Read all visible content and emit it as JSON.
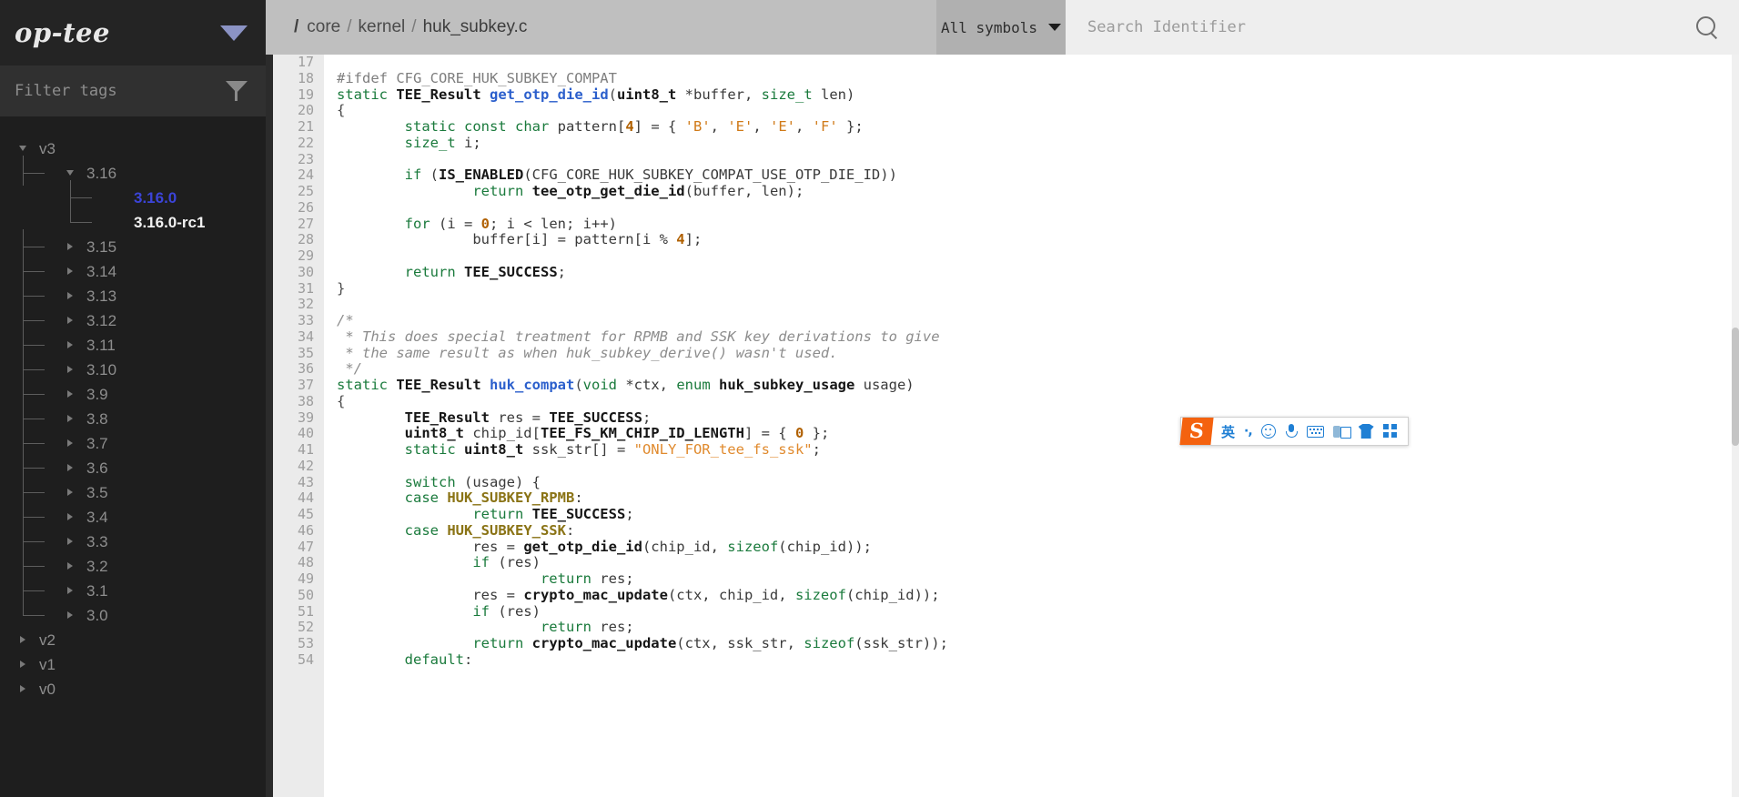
{
  "sidebar": {
    "logo": "op-tee",
    "collapse_icon": "caret-down-icon",
    "filter": {
      "placeholder": "Filter tags",
      "value": "",
      "icon": "funnel-icon"
    },
    "tree": [
      {
        "label": "v3",
        "level": 0,
        "state": "open",
        "kind": "branch",
        "guide": "none"
      },
      {
        "label": "3.16",
        "level": 1,
        "state": "open",
        "kind": "branch",
        "guide": "tee"
      },
      {
        "label": "3.16.0",
        "level": 2,
        "state": "none",
        "kind": "leaf-sel",
        "guide": "tee"
      },
      {
        "label": "3.16.0-rc1",
        "level": 2,
        "state": "none",
        "kind": "leaf",
        "guide": "last"
      },
      {
        "label": "3.15",
        "level": 1,
        "state": "closed",
        "kind": "branch",
        "guide": "tee"
      },
      {
        "label": "3.14",
        "level": 1,
        "state": "closed",
        "kind": "branch",
        "guide": "tee"
      },
      {
        "label": "3.13",
        "level": 1,
        "state": "closed",
        "kind": "branch",
        "guide": "tee"
      },
      {
        "label": "3.12",
        "level": 1,
        "state": "closed",
        "kind": "branch",
        "guide": "tee"
      },
      {
        "label": "3.11",
        "level": 1,
        "state": "closed",
        "kind": "branch",
        "guide": "tee"
      },
      {
        "label": "3.10",
        "level": 1,
        "state": "closed",
        "kind": "branch",
        "guide": "tee"
      },
      {
        "label": "3.9",
        "level": 1,
        "state": "closed",
        "kind": "branch",
        "guide": "tee"
      },
      {
        "label": "3.8",
        "level": 1,
        "state": "closed",
        "kind": "branch",
        "guide": "tee"
      },
      {
        "label": "3.7",
        "level": 1,
        "state": "closed",
        "kind": "branch",
        "guide": "tee"
      },
      {
        "label": "3.6",
        "level": 1,
        "state": "closed",
        "kind": "branch",
        "guide": "tee"
      },
      {
        "label": "3.5",
        "level": 1,
        "state": "closed",
        "kind": "branch",
        "guide": "tee"
      },
      {
        "label": "3.4",
        "level": 1,
        "state": "closed",
        "kind": "branch",
        "guide": "tee"
      },
      {
        "label": "3.3",
        "level": 1,
        "state": "closed",
        "kind": "branch",
        "guide": "tee"
      },
      {
        "label": "3.2",
        "level": 1,
        "state": "closed",
        "kind": "branch",
        "guide": "tee"
      },
      {
        "label": "3.1",
        "level": 1,
        "state": "closed",
        "kind": "branch",
        "guide": "tee"
      },
      {
        "label": "3.0",
        "level": 1,
        "state": "closed",
        "kind": "branch",
        "guide": "last"
      },
      {
        "label": "v2",
        "level": 0,
        "state": "closed",
        "kind": "branch",
        "guide": "none"
      },
      {
        "label": "v1",
        "level": 0,
        "state": "closed",
        "kind": "branch",
        "guide": "none"
      },
      {
        "label": "v0",
        "level": 0,
        "state": "closed",
        "kind": "branch",
        "guide": "none"
      }
    ]
  },
  "topbar": {
    "breadcrumb": {
      "root": "/",
      "segments": [
        "core",
        "kernel",
        "huk_subkey.c"
      ],
      "separator": "/"
    },
    "symbol_filter": {
      "label": "All symbols",
      "icon": "chevron-down-icon"
    },
    "search": {
      "placeholder": "Search Identifier",
      "value": "",
      "icon": "search-icon"
    }
  },
  "code": {
    "first_visible_line": 17,
    "lines": [
      {
        "n": 17,
        "tokens": []
      },
      {
        "n": 18,
        "tokens": [
          {
            "t": "#ifdef ",
            "c": "pp"
          },
          {
            "t": "CFG_CORE_HUK_SUBKEY_COMPAT",
            "c": "pp"
          }
        ]
      },
      {
        "n": 19,
        "tokens": [
          {
            "t": "static ",
            "c": "kw"
          },
          {
            "t": "TEE_Result",
            "c": "typ"
          },
          {
            "t": " ",
            "c": "pln"
          },
          {
            "t": "get_otp_die_id",
            "c": "fn"
          },
          {
            "t": "(",
            "c": "op"
          },
          {
            "t": "uint8_t",
            "c": "typ"
          },
          {
            "t": " *buffer, ",
            "c": "pln"
          },
          {
            "t": "size_t",
            "c": "kw"
          },
          {
            "t": " len)",
            "c": "pln"
          }
        ]
      },
      {
        "n": 20,
        "tokens": [
          {
            "t": "{",
            "c": "op"
          }
        ]
      },
      {
        "n": 21,
        "tokens": [
          {
            "t": "        ",
            "c": "pln"
          },
          {
            "t": "static ",
            "c": "kw"
          },
          {
            "t": "const ",
            "c": "kw"
          },
          {
            "t": "char",
            "c": "kw"
          },
          {
            "t": " pattern[",
            "c": "pln"
          },
          {
            "t": "4",
            "c": "num"
          },
          {
            "t": "] = { ",
            "c": "pln"
          },
          {
            "t": "'B'",
            "c": "chr"
          },
          {
            "t": ", ",
            "c": "pln"
          },
          {
            "t": "'E'",
            "c": "chr"
          },
          {
            "t": ", ",
            "c": "pln"
          },
          {
            "t": "'E'",
            "c": "chr"
          },
          {
            "t": ", ",
            "c": "pln"
          },
          {
            "t": "'F'",
            "c": "chr"
          },
          {
            "t": " };",
            "c": "pln"
          }
        ]
      },
      {
        "n": 22,
        "tokens": [
          {
            "t": "        ",
            "c": "pln"
          },
          {
            "t": "size_t",
            "c": "kw"
          },
          {
            "t": " i;",
            "c": "pln"
          }
        ]
      },
      {
        "n": 23,
        "tokens": []
      },
      {
        "n": 24,
        "tokens": [
          {
            "t": "        ",
            "c": "pln"
          },
          {
            "t": "if",
            "c": "kw"
          },
          {
            "t": " (",
            "c": "pln"
          },
          {
            "t": "IS_ENABLED",
            "c": "mac"
          },
          {
            "t": "(CFG_CORE_HUK_SUBKEY_COMPAT_USE_OTP_DIE_ID))",
            "c": "pln"
          }
        ]
      },
      {
        "n": 25,
        "tokens": [
          {
            "t": "                ",
            "c": "pln"
          },
          {
            "t": "return",
            "c": "kw"
          },
          {
            "t": " ",
            "c": "pln"
          },
          {
            "t": "tee_otp_get_die_id",
            "c": "mac"
          },
          {
            "t": "(buffer, len);",
            "c": "pln"
          }
        ]
      },
      {
        "n": 26,
        "tokens": []
      },
      {
        "n": 27,
        "tokens": [
          {
            "t": "        ",
            "c": "pln"
          },
          {
            "t": "for",
            "c": "kw"
          },
          {
            "t": " (i = ",
            "c": "pln"
          },
          {
            "t": "0",
            "c": "num"
          },
          {
            "t": "; i < len; i++)",
            "c": "pln"
          }
        ]
      },
      {
        "n": 28,
        "tokens": [
          {
            "t": "                ",
            "c": "pln"
          },
          {
            "t": "buffer[i] = pattern[i % ",
            "c": "pln"
          },
          {
            "t": "4",
            "c": "num"
          },
          {
            "t": "];",
            "c": "pln"
          }
        ]
      },
      {
        "n": 29,
        "tokens": []
      },
      {
        "n": 30,
        "tokens": [
          {
            "t": "        ",
            "c": "pln"
          },
          {
            "t": "return",
            "c": "kw"
          },
          {
            "t": " ",
            "c": "pln"
          },
          {
            "t": "TEE_SUCCESS",
            "c": "typ"
          },
          {
            "t": ";",
            "c": "pln"
          }
        ]
      },
      {
        "n": 31,
        "tokens": [
          {
            "t": "}",
            "c": "op"
          }
        ]
      },
      {
        "n": 32,
        "tokens": []
      },
      {
        "n": 33,
        "tokens": [
          {
            "t": "/*",
            "c": "cmt"
          }
        ]
      },
      {
        "n": 34,
        "tokens": [
          {
            "t": " * This does special treatment for RPMB and SSK key derivations to give",
            "c": "cmt"
          }
        ]
      },
      {
        "n": 35,
        "tokens": [
          {
            "t": " * the same result as when huk_subkey_derive() wasn't used.",
            "c": "cmt"
          }
        ]
      },
      {
        "n": 36,
        "tokens": [
          {
            "t": " */",
            "c": "cmt"
          }
        ]
      },
      {
        "n": 37,
        "tokens": [
          {
            "t": "static ",
            "c": "kw"
          },
          {
            "t": "TEE_Result",
            "c": "typ"
          },
          {
            "t": " ",
            "c": "pln"
          },
          {
            "t": "huk_compat",
            "c": "fn"
          },
          {
            "t": "(",
            "c": "op"
          },
          {
            "t": "void",
            "c": "kw"
          },
          {
            "t": " *ctx, ",
            "c": "pln"
          },
          {
            "t": "enum",
            "c": "kw"
          },
          {
            "t": " ",
            "c": "pln"
          },
          {
            "t": "huk_subkey_usage",
            "c": "typ"
          },
          {
            "t": " usage)",
            "c": "pln"
          }
        ]
      },
      {
        "n": 38,
        "tokens": [
          {
            "t": "{",
            "c": "op"
          }
        ]
      },
      {
        "n": 39,
        "tokens": [
          {
            "t": "        ",
            "c": "pln"
          },
          {
            "t": "TEE_Result",
            "c": "typ"
          },
          {
            "t": " res = ",
            "c": "pln"
          },
          {
            "t": "TEE_SUCCESS",
            "c": "typ"
          },
          {
            "t": ";",
            "c": "pln"
          }
        ]
      },
      {
        "n": 40,
        "tokens": [
          {
            "t": "        ",
            "c": "pln"
          },
          {
            "t": "uint8_t",
            "c": "typ"
          },
          {
            "t": " chip_id[",
            "c": "pln"
          },
          {
            "t": "TEE_FS_KM_CHIP_ID_LENGTH",
            "c": "typ"
          },
          {
            "t": "] = { ",
            "c": "pln"
          },
          {
            "t": "0",
            "c": "num"
          },
          {
            "t": " };",
            "c": "pln"
          }
        ]
      },
      {
        "n": 41,
        "tokens": [
          {
            "t": "        ",
            "c": "pln"
          },
          {
            "t": "static ",
            "c": "kw"
          },
          {
            "t": "uint8_t",
            "c": "typ"
          },
          {
            "t": " ssk_str[] = ",
            "c": "pln"
          },
          {
            "t": "\"ONLY_FOR_tee_fs_ssk\"",
            "c": "str"
          },
          {
            "t": ";",
            "c": "pln"
          }
        ]
      },
      {
        "n": 42,
        "tokens": []
      },
      {
        "n": 43,
        "tokens": [
          {
            "t": "        ",
            "c": "pln"
          },
          {
            "t": "switch",
            "c": "kw"
          },
          {
            "t": " (usage) {",
            "c": "pln"
          }
        ]
      },
      {
        "n": 44,
        "tokens": [
          {
            "t": "        ",
            "c": "pln"
          },
          {
            "t": "case",
            "c": "kw"
          },
          {
            "t": " ",
            "c": "pln"
          },
          {
            "t": "HUK_SUBKEY_RPMB",
            "c": "enm"
          },
          {
            "t": ":",
            "c": "pln"
          }
        ]
      },
      {
        "n": 45,
        "tokens": [
          {
            "t": "                ",
            "c": "pln"
          },
          {
            "t": "return",
            "c": "kw"
          },
          {
            "t": " ",
            "c": "pln"
          },
          {
            "t": "TEE_SUCCESS",
            "c": "typ"
          },
          {
            "t": ";",
            "c": "pln"
          }
        ]
      },
      {
        "n": 46,
        "tokens": [
          {
            "t": "        ",
            "c": "pln"
          },
          {
            "t": "case",
            "c": "kw"
          },
          {
            "t": " ",
            "c": "pln"
          },
          {
            "t": "HUK_SUBKEY_SSK",
            "c": "enm"
          },
          {
            "t": ":",
            "c": "pln"
          }
        ]
      },
      {
        "n": 47,
        "tokens": [
          {
            "t": "                ",
            "c": "pln"
          },
          {
            "t": "res = ",
            "c": "pln"
          },
          {
            "t": "get_otp_die_id",
            "c": "mac"
          },
          {
            "t": "(chip_id, ",
            "c": "pln"
          },
          {
            "t": "sizeof",
            "c": "kw"
          },
          {
            "t": "(chip_id));",
            "c": "pln"
          }
        ]
      },
      {
        "n": 48,
        "tokens": [
          {
            "t": "                ",
            "c": "pln"
          },
          {
            "t": "if",
            "c": "kw"
          },
          {
            "t": " (res)",
            "c": "pln"
          }
        ]
      },
      {
        "n": 49,
        "tokens": [
          {
            "t": "                        ",
            "c": "pln"
          },
          {
            "t": "return",
            "c": "kw"
          },
          {
            "t": " res;",
            "c": "pln"
          }
        ]
      },
      {
        "n": 50,
        "tokens": [
          {
            "t": "                ",
            "c": "pln"
          },
          {
            "t": "res = ",
            "c": "pln"
          },
          {
            "t": "crypto_mac_update",
            "c": "mac"
          },
          {
            "t": "(ctx, chip_id, ",
            "c": "pln"
          },
          {
            "t": "sizeof",
            "c": "kw"
          },
          {
            "t": "(chip_id));",
            "c": "pln"
          }
        ]
      },
      {
        "n": 51,
        "tokens": [
          {
            "t": "                ",
            "c": "pln"
          },
          {
            "t": "if",
            "c": "kw"
          },
          {
            "t": " (res)",
            "c": "pln"
          }
        ]
      },
      {
        "n": 52,
        "tokens": [
          {
            "t": "                        ",
            "c": "pln"
          },
          {
            "t": "return",
            "c": "kw"
          },
          {
            "t": " res;",
            "c": "pln"
          }
        ]
      },
      {
        "n": 53,
        "tokens": [
          {
            "t": "                ",
            "c": "pln"
          },
          {
            "t": "return",
            "c": "kw"
          },
          {
            "t": " ",
            "c": "pln"
          },
          {
            "t": "crypto_mac_update",
            "c": "mac"
          },
          {
            "t": "(ctx, ssk_str, ",
            "c": "pln"
          },
          {
            "t": "sizeof",
            "c": "kw"
          },
          {
            "t": "(ssk_str));",
            "c": "pln"
          }
        ]
      },
      {
        "n": 54,
        "tokens": [
          {
            "t": "        ",
            "c": "pln"
          },
          {
            "t": "default",
            "c": "kw"
          },
          {
            "t": ":",
            "c": "pln"
          }
        ]
      }
    ]
  },
  "ime_toolbar": {
    "logo": "S",
    "items": [
      {
        "icon": "language-mode-chinese-icon",
        "label": "英"
      },
      {
        "icon": "punctuation-toggle-icon",
        "label": "·,"
      },
      {
        "icon": "emoji-smiley-icon",
        "label": ""
      },
      {
        "icon": "microphone-icon",
        "label": ""
      },
      {
        "icon": "soft-keyboard-icon",
        "label": ""
      },
      {
        "icon": "screenshot-tool-icon",
        "label": ""
      },
      {
        "icon": "skin-shirt-icon",
        "label": ""
      },
      {
        "icon": "toolbox-grid-icon",
        "label": ""
      }
    ]
  },
  "colors": {
    "sidebar_bg": "#1e1e1e",
    "topbar_bg": "#bfbfbf",
    "accent_blue": "#3b44d8",
    "ime_orange": "#f4620f",
    "ime_blue": "#1f7fd4"
  }
}
